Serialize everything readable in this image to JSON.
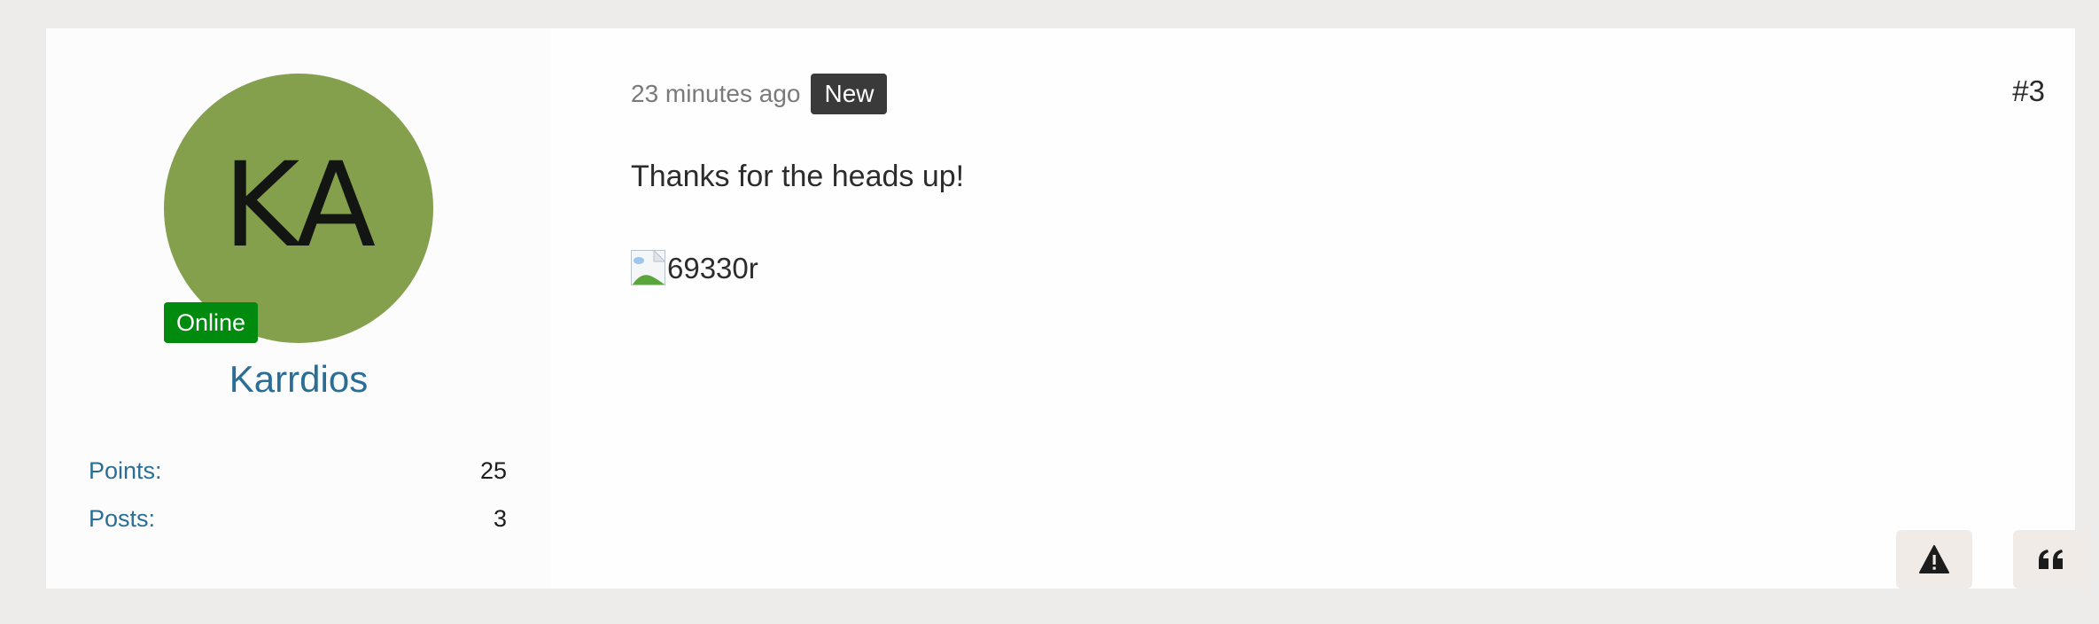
{
  "post": {
    "number": "#3",
    "timestamp": "23 minutes ago",
    "badge": "New",
    "message": "Thanks for the heads up!",
    "attachment_alt": "69330r"
  },
  "user": {
    "initials": "KA",
    "avatar_color": "#84a04d",
    "status": "Online",
    "name": "Karrdios",
    "stats": [
      {
        "label": "Points:",
        "value": "25"
      },
      {
        "label": "Posts:",
        "value": "3"
      }
    ]
  },
  "actions": {
    "report_icon": "warning-triangle-icon",
    "quote_icon": "quote-icon"
  }
}
